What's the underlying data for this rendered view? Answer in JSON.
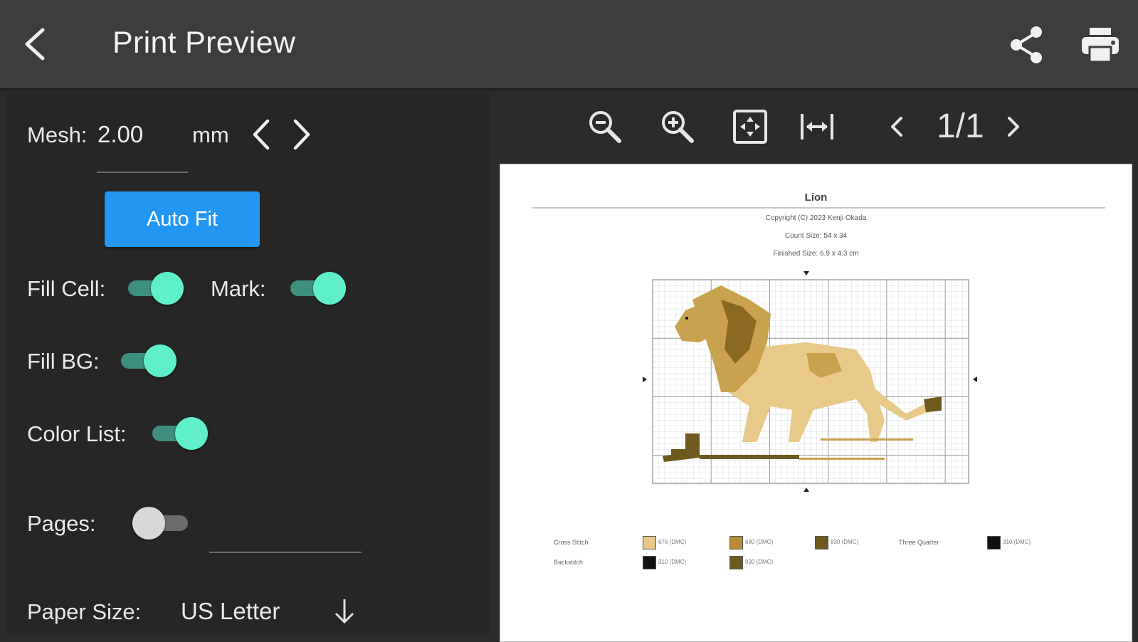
{
  "app_bar": {
    "title": "Print Preview",
    "back_icon": "back-arrow-icon",
    "share_icon": "share-icon",
    "print_icon": "print-icon"
  },
  "settings": {
    "mesh_label": "Mesh:",
    "mesh_value": "2.00",
    "mesh_unit": "mm",
    "auto_fit_label": "Auto Fit",
    "fill_cell_label": "Fill Cell:",
    "fill_cell_on": true,
    "mark_label": "Mark:",
    "mark_on": true,
    "fill_bg_label": "Fill BG:",
    "fill_bg_on": true,
    "color_list_label": "Color List:",
    "color_list_on": true,
    "pages_label": "Pages:",
    "pages_on": false,
    "paper_size_label": "Paper Size:",
    "paper_size_value": "US Letter"
  },
  "preview": {
    "zoom_out_icon": "zoom-out-icon",
    "zoom_in_icon": "zoom-in-icon",
    "fit_page_icon": "fit-page-icon",
    "fit_width_icon": "fit-width-icon",
    "page_counter": "1/1"
  },
  "sheet": {
    "title": "Lion",
    "copyright": "Copyright (C) 2023 Kenji Okada",
    "count_size": "Count Size: 54 x 34",
    "finished_size": "Finished Size: 6.9 x 4.3 cm",
    "legend": {
      "cross_stitch_label": "Cross Stitch",
      "backstitch_label": "Backstitch",
      "three_quarter_label": "Three Quarter",
      "cross_stitch_colors": [
        {
          "code": "676 (DMC)",
          "color": "#e8c98a"
        },
        {
          "code": "680 (DMC)",
          "color": "#b88a34"
        },
        {
          "code": "830 (DMC)",
          "color": "#6e5a1e"
        }
      ],
      "three_quarter_colors": [
        {
          "code": "310 (DMC)",
          "color": "#111111"
        }
      ],
      "backstitch_colors": [
        {
          "code": "310 (DMC)",
          "color": "#111111"
        },
        {
          "code": "830 (DMC)",
          "color": "#6e5a1e"
        }
      ]
    },
    "palette": {
      "light": "#e8c98a",
      "mid": "#c9a24f",
      "dark": "#8a6a22",
      "darker": "#6e5a1e",
      "eye": "#111111"
    }
  }
}
